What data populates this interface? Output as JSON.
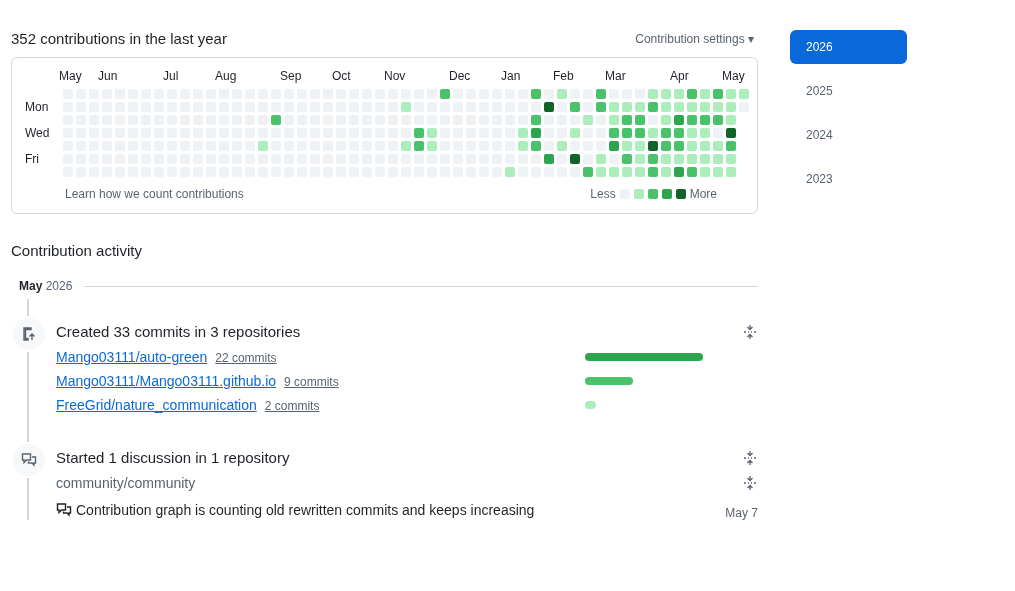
{
  "heading": "352 contributions in the last year",
  "settings": {
    "label": "Contribution settings",
    "caret": "▾"
  },
  "calendar": {
    "day_labels": [
      "Mon",
      "Wed",
      "Fri"
    ],
    "weeks": [
      {
        "month": "May",
        "days": [
          {
            "color": "#eff2f5"
          },
          {
            "color": "#eff2f5"
          },
          {
            "color": "#eff2f5"
          },
          {
            "color": "#eff2f5"
          },
          {
            "color": "#eff2f5"
          },
          {
            "color": "#eff2f5"
          },
          {
            "color": "#eff2f5"
          }
        ]
      },
      {
        "days": [
          {
            "color": "#eff2f5"
          },
          {
            "color": "#eff2f5"
          },
          {
            "color": "#eff2f5"
          },
          {
            "color": "#eff2f5"
          },
          {
            "color": "#eff2f5"
          },
          {
            "color": "#eff2f5"
          },
          {
            "color": "#eff2f5"
          }
        ]
      },
      {
        "days": [
          {
            "color": "#eff2f5"
          },
          {
            "color": "#eff2f5"
          },
          {
            "color": "#eff2f5"
          },
          {
            "color": "#eff2f5"
          },
          {
            "color": "#eff2f5"
          },
          {
            "color": "#eff2f5"
          },
          {
            "color": "#eff2f5"
          }
        ]
      },
      {
        "month": "Jun",
        "days": [
          {
            "color": "#eff2f5"
          },
          {
            "color": "#eff2f5"
          },
          {
            "color": "#eff2f5"
          },
          {
            "color": "#eff2f5"
          },
          {
            "color": "#eff2f5"
          },
          {
            "color": "#eff2f5"
          },
          {
            "color": "#eff2f5"
          }
        ]
      },
      {
        "days": [
          {
            "color": "#eff2f5"
          },
          {
            "color": "#eff2f5"
          },
          {
            "color": "#eff2f5"
          },
          {
            "color": "#eff2f5"
          },
          {
            "color": "#eff2f5"
          },
          {
            "color": "#eff2f5"
          },
          {
            "color": "#eff2f5"
          }
        ]
      },
      {
        "days": [
          {
            "color": "#eff2f5"
          },
          {
            "color": "#eff2f5"
          },
          {
            "color": "#eff2f5"
          },
          {
            "color": "#eff2f5"
          },
          {
            "color": "#eff2f5"
          },
          {
            "color": "#eff2f5"
          },
          {
            "color": "#eff2f5"
          }
        ]
      },
      {
        "days": [
          {
            "color": "#eff2f5"
          },
          {
            "color": "#eff2f5"
          },
          {
            "color": "#eff2f5"
          },
          {
            "color": "#eff2f5"
          },
          {
            "color": "#eff2f5"
          },
          {
            "color": "#eff2f5"
          },
          {
            "color": "#eff2f5"
          }
        ]
      },
      {
        "days": [
          {
            "color": "#eff2f5"
          },
          {
            "color": "#eff2f5"
          },
          {
            "color": "#eff2f5"
          },
          {
            "color": "#eff2f5"
          },
          {
            "color": "#eff2f5"
          },
          {
            "color": "#eff2f5"
          },
          {
            "color": "#eff2f5"
          }
        ]
      },
      {
        "month": "Jul",
        "days": [
          {
            "color": "#eff2f5"
          },
          {
            "color": "#eff2f5"
          },
          {
            "color": "#eff2f5"
          },
          {
            "color": "#eff2f5"
          },
          {
            "color": "#eff2f5"
          },
          {
            "color": "#eff2f5"
          },
          {
            "color": "#eff2f5"
          }
        ]
      },
      {
        "days": [
          {
            "color": "#eff2f5"
          },
          {
            "color": "#eff2f5"
          },
          {
            "color": "#eff2f5"
          },
          {
            "color": "#eff2f5"
          },
          {
            "color": "#eff2f5"
          },
          {
            "color": "#eff2f5"
          },
          {
            "color": "#eff2f5"
          }
        ]
      },
      {
        "days": [
          {
            "color": "#eff2f5"
          },
          {
            "color": "#eff2f5"
          },
          {
            "color": "#eff2f5"
          },
          {
            "color": "#eff2f5"
          },
          {
            "color": "#eff2f5"
          },
          {
            "color": "#eff2f5"
          },
          {
            "color": "#eff2f5"
          }
        ]
      },
      {
        "days": [
          {
            "color": "#eff2f5"
          },
          {
            "color": "#eff2f5"
          },
          {
            "color": "#eff2f5"
          },
          {
            "color": "#eff2f5"
          },
          {
            "color": "#eff2f5"
          },
          {
            "color": "#eff2f5"
          },
          {
            "color": "#eff2f5"
          }
        ]
      },
      {
        "month": "Aug",
        "days": [
          {
            "color": "#eff2f5"
          },
          {
            "color": "#eff2f5"
          },
          {
            "color": "#eff2f5"
          },
          {
            "color": "#eff2f5"
          },
          {
            "color": "#eff2f5"
          },
          {
            "color": "#eff2f5"
          },
          {
            "color": "#eff2f5"
          }
        ]
      },
      {
        "days": [
          {
            "color": "#eff2f5"
          },
          {
            "color": "#eff2f5"
          },
          {
            "color": "#eff2f5"
          },
          {
            "color": "#eff2f5"
          },
          {
            "color": "#eff2f5"
          },
          {
            "color": "#eff2f5"
          },
          {
            "color": "#eff2f5"
          }
        ]
      },
      {
        "days": [
          {
            "color": "#eff2f5"
          },
          {
            "color": "#eff2f5"
          },
          {
            "color": "#eff2f5"
          },
          {
            "color": "#eff2f5"
          },
          {
            "color": "#eff2f5"
          },
          {
            "color": "#eff2f5"
          },
          {
            "color": "#eff2f5"
          }
        ]
      },
      {
        "days": [
          {
            "color": "#eff2f5"
          },
          {
            "color": "#eff2f5"
          },
          {
            "color": "#eff2f5"
          },
          {
            "color": "#eff2f5"
          },
          {
            "color": "#aceebb"
          },
          {
            "color": "#eff2f5"
          },
          {
            "color": "#eff2f5"
          }
        ]
      },
      {
        "days": [
          {
            "color": "#eff2f5"
          },
          {
            "color": "#eff2f5"
          },
          {
            "color": "#4ac26b"
          },
          {
            "color": "#eff2f5"
          },
          {
            "color": "#eff2f5"
          },
          {
            "color": "#eff2f5"
          },
          {
            "color": "#eff2f5"
          }
        ]
      },
      {
        "month": "Sep",
        "days": [
          {
            "color": "#eff2f5"
          },
          {
            "color": "#eff2f5"
          },
          {
            "color": "#eff2f5"
          },
          {
            "color": "#eff2f5"
          },
          {
            "color": "#eff2f5"
          },
          {
            "color": "#eff2f5"
          },
          {
            "color": "#eff2f5"
          }
        ]
      },
      {
        "days": [
          {
            "color": "#eff2f5"
          },
          {
            "color": "#eff2f5"
          },
          {
            "color": "#eff2f5"
          },
          {
            "color": "#eff2f5"
          },
          {
            "color": "#eff2f5"
          },
          {
            "color": "#eff2f5"
          },
          {
            "color": "#eff2f5"
          }
        ]
      },
      {
        "days": [
          {
            "color": "#eff2f5"
          },
          {
            "color": "#eff2f5"
          },
          {
            "color": "#eff2f5"
          },
          {
            "color": "#eff2f5"
          },
          {
            "color": "#eff2f5"
          },
          {
            "color": "#eff2f5"
          },
          {
            "color": "#eff2f5"
          }
        ]
      },
      {
        "days": [
          {
            "color": "#eff2f5"
          },
          {
            "color": "#eff2f5"
          },
          {
            "color": "#eff2f5"
          },
          {
            "color": "#eff2f5"
          },
          {
            "color": "#eff2f5"
          },
          {
            "color": "#eff2f5"
          },
          {
            "color": "#eff2f5"
          }
        ]
      },
      {
        "month": "Oct",
        "days": [
          {
            "color": "#eff2f5"
          },
          {
            "color": "#eff2f5"
          },
          {
            "color": "#eff2f5"
          },
          {
            "color": "#eff2f5"
          },
          {
            "color": "#eff2f5"
          },
          {
            "color": "#eff2f5"
          },
          {
            "color": "#eff2f5"
          }
        ]
      },
      {
        "days": [
          {
            "color": "#eff2f5"
          },
          {
            "color": "#eff2f5"
          },
          {
            "color": "#eff2f5"
          },
          {
            "color": "#eff2f5"
          },
          {
            "color": "#eff2f5"
          },
          {
            "color": "#eff2f5"
          },
          {
            "color": "#eff2f5"
          }
        ]
      },
      {
        "days": [
          {
            "color": "#eff2f5"
          },
          {
            "color": "#eff2f5"
          },
          {
            "color": "#eff2f5"
          },
          {
            "color": "#eff2f5"
          },
          {
            "color": "#eff2f5"
          },
          {
            "color": "#eff2f5"
          },
          {
            "color": "#eff2f5"
          }
        ]
      },
      {
        "days": [
          {
            "color": "#eff2f5"
          },
          {
            "color": "#eff2f5"
          },
          {
            "color": "#eff2f5"
          },
          {
            "color": "#eff2f5"
          },
          {
            "color": "#eff2f5"
          },
          {
            "color": "#eff2f5"
          },
          {
            "color": "#eff2f5"
          }
        ]
      },
      {
        "month": "Nov",
        "days": [
          {
            "color": "#eff2f5"
          },
          {
            "color": "#eff2f5"
          },
          {
            "color": "#eff2f5"
          },
          {
            "color": "#eff2f5"
          },
          {
            "color": "#eff2f5"
          },
          {
            "color": "#eff2f5"
          },
          {
            "color": "#eff2f5"
          }
        ]
      },
      {
        "days": [
          {
            "color": "#eff2f5"
          },
          {
            "color": "#aceebb"
          },
          {
            "color": "#eff2f5"
          },
          {
            "color": "#eff2f5"
          },
          {
            "color": "#aceebb"
          },
          {
            "color": "#eff2f5"
          },
          {
            "color": "#eff2f5"
          }
        ]
      },
      {
        "days": [
          {
            "color": "#eff2f5"
          },
          {
            "color": "#eff2f5"
          },
          {
            "color": "#eff2f5"
          },
          {
            "color": "#4ac26b"
          },
          {
            "color": "#4ac26b"
          },
          {
            "color": "#eff2f5"
          },
          {
            "color": "#eff2f5"
          }
        ]
      },
      {
        "days": [
          {
            "color": "#eff2f5"
          },
          {
            "color": "#eff2f5"
          },
          {
            "color": "#eff2f5"
          },
          {
            "color": "#aceebb"
          },
          {
            "color": "#aceebb"
          },
          {
            "color": "#eff2f5"
          },
          {
            "color": "#eff2f5"
          }
        ]
      },
      {
        "days": [
          {
            "color": "#4ac26b"
          },
          {
            "color": "#eff2f5"
          },
          {
            "color": "#eff2f5"
          },
          {
            "color": "#eff2f5"
          },
          {
            "color": "#eff2f5"
          },
          {
            "color": "#eff2f5"
          },
          {
            "color": "#eff2f5"
          }
        ]
      },
      {
        "month": "Dec",
        "days": [
          {
            "color": "#eff2f5"
          },
          {
            "color": "#eff2f5"
          },
          {
            "color": "#eff2f5"
          },
          {
            "color": "#eff2f5"
          },
          {
            "color": "#eff2f5"
          },
          {
            "color": "#eff2f5"
          },
          {
            "color": "#eff2f5"
          }
        ]
      },
      {
        "days": [
          {
            "color": "#eff2f5"
          },
          {
            "color": "#eff2f5"
          },
          {
            "color": "#eff2f5"
          },
          {
            "color": "#eff2f5"
          },
          {
            "color": "#eff2f5"
          },
          {
            "color": "#eff2f5"
          },
          {
            "color": "#eff2f5"
          }
        ]
      },
      {
        "days": [
          {
            "color": "#eff2f5"
          },
          {
            "color": "#eff2f5"
          },
          {
            "color": "#eff2f5"
          },
          {
            "color": "#eff2f5"
          },
          {
            "color": "#eff2f5"
          },
          {
            "color": "#eff2f5"
          },
          {
            "color": "#eff2f5"
          }
        ]
      },
      {
        "days": [
          {
            "color": "#eff2f5"
          },
          {
            "color": "#eff2f5"
          },
          {
            "color": "#eff2f5"
          },
          {
            "color": "#eff2f5"
          },
          {
            "color": "#eff2f5"
          },
          {
            "color": "#eff2f5"
          },
          {
            "color": "#eff2f5"
          }
        ]
      },
      {
        "month": "Jan",
        "days": [
          {
            "color": "#eff2f5"
          },
          {
            "color": "#eff2f5"
          },
          {
            "color": "#eff2f5"
          },
          {
            "color": "#eff2f5"
          },
          {
            "color": "#eff2f5"
          },
          {
            "color": "#eff2f5"
          },
          {
            "color": "#aceebb"
          }
        ]
      },
      {
        "days": [
          {
            "color": "#eff2f5"
          },
          {
            "color": "#eff2f5"
          },
          {
            "color": "#eff2f5"
          },
          {
            "color": "#aceebb"
          },
          {
            "color": "#aceebb"
          },
          {
            "color": "#eff2f5"
          },
          {
            "color": "#eff2f5"
          }
        ]
      },
      {
        "days": [
          {
            "color": "#4ac26b"
          },
          {
            "color": "#eff2f5"
          },
          {
            "color": "#4ac26b"
          },
          {
            "color": "#2da44e"
          },
          {
            "color": "#4ac26b"
          },
          {
            "color": "#eff2f5"
          },
          {
            "color": "#eff2f5"
          }
        ]
      },
      {
        "days": [
          {
            "color": "#eff2f5"
          },
          {
            "color": "#116329"
          },
          {
            "color": "#eff2f5"
          },
          {
            "color": "#eff2f5"
          },
          {
            "color": "#eff2f5"
          },
          {
            "color": "#2da44e"
          },
          {
            "color": "#eff2f5"
          }
        ]
      },
      {
        "month": "Feb",
        "days": [
          {
            "color": "#aceebb"
          },
          {
            "color": "#eff2f5"
          },
          {
            "color": "#eff2f5"
          },
          {
            "color": "#eff2f5"
          },
          {
            "color": "#aceebb"
          },
          {
            "color": "#eff2f5"
          },
          {
            "color": "#eff2f5"
          }
        ]
      },
      {
        "days": [
          {
            "color": "#eff2f5"
          },
          {
            "color": "#4ac26b"
          },
          {
            "color": "#eff2f5"
          },
          {
            "color": "#aceebb"
          },
          {
            "color": "#eff2f5"
          },
          {
            "color": "#116329"
          },
          {
            "color": "#eff2f5"
          }
        ]
      },
      {
        "days": [
          {
            "color": "#eff2f5"
          },
          {
            "color": "#eff2f5"
          },
          {
            "color": "#aceebb"
          },
          {
            "color": "#eff2f5"
          },
          {
            "color": "#eff2f5"
          },
          {
            "color": "#eff2f5"
          },
          {
            "color": "#4ac26b"
          }
        ]
      },
      {
        "days": [
          {
            "color": "#4ac26b"
          },
          {
            "color": "#4ac26b"
          },
          {
            "color": "#eff2f5"
          },
          {
            "color": "#eff2f5"
          },
          {
            "color": "#eff2f5"
          },
          {
            "color": "#aceebb"
          },
          {
            "color": "#aceebb"
          }
        ]
      },
      {
        "month": "Mar",
        "days": [
          {
            "color": "#eff2f5"
          },
          {
            "color": "#aceebb"
          },
          {
            "color": "#aceebb"
          },
          {
            "color": "#4ac26b"
          },
          {
            "color": "#2da44e"
          },
          {
            "color": "#eff2f5"
          },
          {
            "color": "#aceebb"
          }
        ]
      },
      {
        "days": [
          {
            "color": "#eff2f5"
          },
          {
            "color": "#aceebb"
          },
          {
            "color": "#4ac26b"
          },
          {
            "color": "#4ac26b"
          },
          {
            "color": "#aceebb"
          },
          {
            "color": "#4ac26b"
          },
          {
            "color": "#aceebb"
          }
        ]
      },
      {
        "days": [
          {
            "color": "#eff2f5"
          },
          {
            "color": "#aceebb"
          },
          {
            "color": "#4ac26b"
          },
          {
            "color": "#4ac26b"
          },
          {
            "color": "#aceebb"
          },
          {
            "color": "#aceebb"
          },
          {
            "color": "#aceebb"
          }
        ]
      },
      {
        "days": [
          {
            "color": "#aceebb"
          },
          {
            "color": "#4ac26b"
          },
          {
            "color": "#eff2f5"
          },
          {
            "color": "#aceebb"
          },
          {
            "color": "#116329"
          },
          {
            "color": "#4ac26b"
          },
          {
            "color": "#4ac26b"
          }
        ]
      },
      {
        "days": [
          {
            "color": "#aceebb"
          },
          {
            "color": "#aceebb"
          },
          {
            "color": "#aceebb"
          },
          {
            "color": "#4ac26b"
          },
          {
            "color": "#4ac26b"
          },
          {
            "color": "#aceebb"
          },
          {
            "color": "#aceebb"
          }
        ]
      },
      {
        "month": "Apr",
        "days": [
          {
            "color": "#aceebb"
          },
          {
            "color": "#aceebb"
          },
          {
            "color": "#2da44e"
          },
          {
            "color": "#4ac26b"
          },
          {
            "color": "#4ac26b"
          },
          {
            "color": "#aceebb"
          },
          {
            "color": "#2da44e"
          }
        ]
      },
      {
        "days": [
          {
            "color": "#4ac26b"
          },
          {
            "color": "#aceebb"
          },
          {
            "color": "#4ac26b"
          },
          {
            "color": "#aceebb"
          },
          {
            "color": "#aceebb"
          },
          {
            "color": "#aceebb"
          },
          {
            "color": "#4ac26b"
          }
        ]
      },
      {
        "days": [
          {
            "color": "#aceebb"
          },
          {
            "color": "#aceebb"
          },
          {
            "color": "#4ac26b"
          },
          {
            "color": "#aceebb"
          },
          {
            "color": "#aceebb"
          },
          {
            "color": "#aceebb"
          },
          {
            "color": "#aceebb"
          }
        ]
      },
      {
        "days": [
          {
            "color": "#4ac26b"
          },
          {
            "color": "#aceebb"
          },
          {
            "color": "#4ac26b"
          },
          {
            "color": "#eff2f5"
          },
          {
            "color": "#aceebb"
          },
          {
            "color": "#aceebb"
          },
          {
            "color": "#aceebb"
          }
        ]
      },
      {
        "month": "May",
        "days": [
          {
            "color": "#aceebb"
          },
          {
            "color": "#aceebb"
          },
          {
            "color": "#aceebb"
          },
          {
            "color": "#116329"
          },
          {
            "color": "#4ac26b"
          },
          {
            "color": "#aceebb"
          },
          {
            "color": "#aceebb"
          }
        ]
      },
      {
        "days": [
          {
            "color": "#aceebb"
          },
          {
            "color": "#eff2f5"
          }
        ]
      }
    ],
    "learn_link": "Learn how we count contributions",
    "less": "Less",
    "more": "More"
  },
  "years": [
    {
      "label": "2026",
      "selected": true
    },
    {
      "label": "2025",
      "selected": false
    },
    {
      "label": "2024",
      "selected": false
    },
    {
      "label": "2023",
      "selected": false
    }
  ],
  "activity": {
    "title": "Contribution activity",
    "month": "May",
    "year": "2026",
    "events": [
      {
        "kind": "commits",
        "title": "Created 33 commits in 3 repositories",
        "repos": [
          {
            "name": "Mango03111/auto-green",
            "count": "22 commits",
            "color": "#2da44e"
          },
          {
            "name": "Mango03111/Mango03111.github.io",
            "count": "9 commits",
            "color": "#4ac26b"
          },
          {
            "name": "FreeGrid/nature_communication",
            "count": "2 commits",
            "color": "#aceebb"
          }
        ]
      },
      {
        "kind": "discussion",
        "title": "Started 1 discussion in 1 repository",
        "repo": "community/community",
        "item": "Contribution graph is counting old rewritten commits and keeps increasing",
        "date": "May 7"
      }
    ]
  }
}
